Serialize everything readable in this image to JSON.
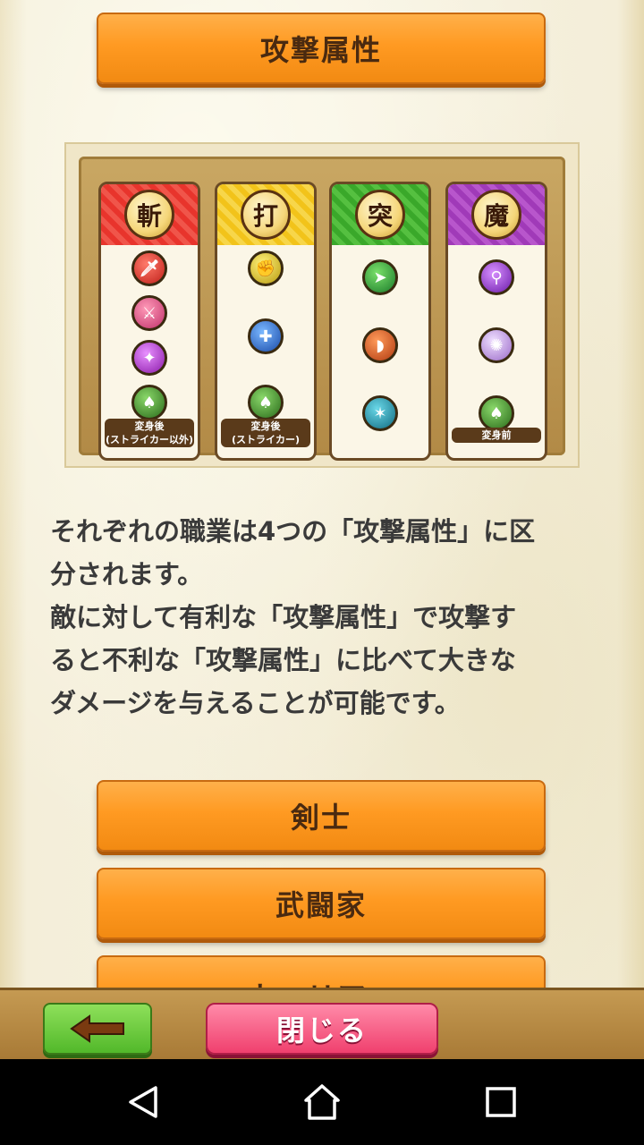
{
  "header": {
    "title": "攻撃属性"
  },
  "attribute_table": {
    "columns": [
      {
        "label": "斬",
        "color": "#e8342c",
        "icons": [
          "sword-icon",
          "dagger-icon",
          "gauntlet-icon",
          "transform-icon"
        ],
        "tag": "変身後\n(ストライカー以外)"
      },
      {
        "label": "打",
        "color": "#f2c31a",
        "icons": [
          "fist-icon",
          "hammer-icon",
          "transform-icon"
        ],
        "tag": "変身後\n(ストライカー)"
      },
      {
        "label": "突",
        "color": "#3aa82a",
        "icons": [
          "spear-icon",
          "bow-icon",
          "claw-icon"
        ],
        "tag": ""
      },
      {
        "label": "魔",
        "color": "#a03ab8",
        "icons": [
          "staff-icon",
          "magic-circle-icon",
          "transform-icon"
        ],
        "tag": "変身前"
      }
    ]
  },
  "description": {
    "text": "それぞれの職業は4つの「攻撃属性」に区\n分されます。\n敵に対して有利な「攻撃属性」で攻撃す\nると不利な「攻撃属性」に比べて大きな\nダメージを与えることが可能です。"
  },
  "job_buttons": [
    {
      "label": "剣士"
    },
    {
      "label": "武闘家"
    },
    {
      "label": "ウォリアー"
    }
  ],
  "footer": {
    "back_icon": "left-arrow-icon",
    "close_label": "閉じる"
  },
  "navbar": {
    "back_icon": "triangle-back-icon",
    "home_icon": "home-icon",
    "recents_icon": "square-recents-icon"
  }
}
